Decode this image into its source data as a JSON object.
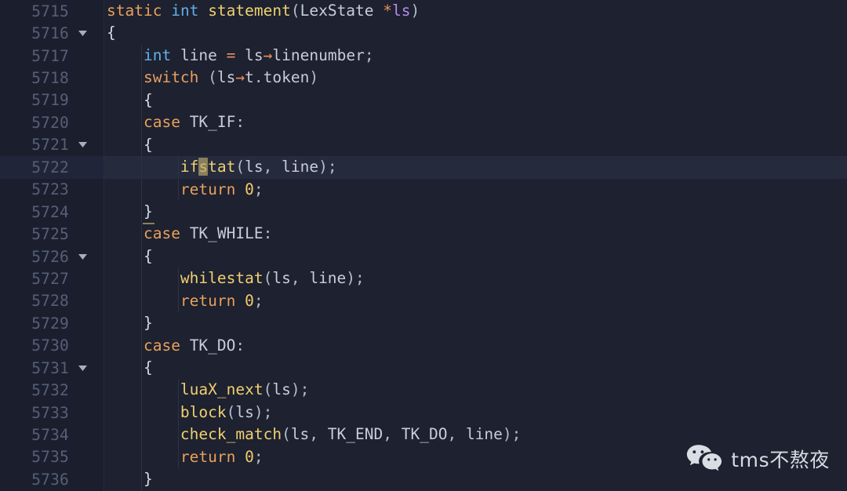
{
  "editor": {
    "theme": "dark",
    "background": "#1d2130",
    "gutter_background": "#1b1f2d",
    "active_line_background": "#252a3d",
    "line_number_color": "#565f78",
    "cursor_color": "#9a8e63",
    "language": "C",
    "active_line": 5722,
    "colors": {
      "keyword": "#e8a05c",
      "type": "#62b0e8",
      "function": "#f0d070",
      "identifier": "#c8cdd8",
      "operator": "#e8905c",
      "punctuation": "#b6bccb",
      "number": "#f5c96b",
      "parameter": "#b48ee8",
      "bracket_match_underline": "#8d8258"
    }
  },
  "lines": [
    {
      "number": "5715",
      "fold": false,
      "indent": 0,
      "tokens": [
        {
          "t": "static",
          "c": "kw"
        },
        {
          "t": " ",
          "c": "plain"
        },
        {
          "t": "int",
          "c": "type"
        },
        {
          "t": " ",
          "c": "plain"
        },
        {
          "t": "statement",
          "c": "fn"
        },
        {
          "t": "(",
          "c": "punct"
        },
        {
          "t": "LexState",
          "c": "ident"
        },
        {
          "t": " ",
          "c": "plain"
        },
        {
          "t": "*",
          "c": "op"
        },
        {
          "t": "ls",
          "c": "var"
        },
        {
          "t": ")",
          "c": "punct"
        }
      ]
    },
    {
      "number": "5716",
      "fold": true,
      "indent": 0,
      "tokens": [
        {
          "t": "{",
          "c": "brace"
        }
      ]
    },
    {
      "number": "5717",
      "fold": false,
      "indent": 1,
      "tokens": [
        {
          "t": "    ",
          "c": "plain"
        },
        {
          "t": "int",
          "c": "type"
        },
        {
          "t": " ",
          "c": "plain"
        },
        {
          "t": "line",
          "c": "ident"
        },
        {
          "t": " ",
          "c": "plain"
        },
        {
          "t": "=",
          "c": "op"
        },
        {
          "t": " ",
          "c": "plain"
        },
        {
          "t": "ls",
          "c": "ident"
        },
        {
          "t": "→",
          "c": "op"
        },
        {
          "t": "linenumber",
          "c": "ident"
        },
        {
          "t": ";",
          "c": "punct"
        }
      ]
    },
    {
      "number": "5718",
      "fold": false,
      "indent": 1,
      "tokens": [
        {
          "t": "    ",
          "c": "plain"
        },
        {
          "t": "switch",
          "c": "kw"
        },
        {
          "t": " ",
          "c": "plain"
        },
        {
          "t": "(",
          "c": "punct"
        },
        {
          "t": "ls",
          "c": "ident"
        },
        {
          "t": "→",
          "c": "op"
        },
        {
          "t": "t",
          "c": "ident"
        },
        {
          "t": ".",
          "c": "punct"
        },
        {
          "t": "token",
          "c": "ident"
        },
        {
          "t": ")",
          "c": "punct"
        }
      ]
    },
    {
      "number": "5719",
      "fold": false,
      "indent": 1,
      "tokens": [
        {
          "t": "    ",
          "c": "plain"
        },
        {
          "t": "{",
          "c": "brace"
        }
      ]
    },
    {
      "number": "5720",
      "fold": false,
      "indent": 1,
      "tokens": [
        {
          "t": "    ",
          "c": "plain"
        },
        {
          "t": "case",
          "c": "kw"
        },
        {
          "t": " ",
          "c": "plain"
        },
        {
          "t": "TK_IF",
          "c": "ident"
        },
        {
          "t": ":",
          "c": "punct"
        }
      ]
    },
    {
      "number": "5721",
      "fold": true,
      "indent": 1,
      "tokens": [
        {
          "t": "    ",
          "c": "plain"
        },
        {
          "t": "{",
          "c": "match"
        }
      ]
    },
    {
      "number": "5722",
      "fold": false,
      "indent": 2,
      "active": true,
      "tokens": [
        {
          "t": "        ",
          "c": "plain"
        },
        {
          "t": "if",
          "c": "fn"
        },
        {
          "t": "s",
          "c": "fn cursor"
        },
        {
          "t": "tat",
          "c": "fn"
        },
        {
          "t": "(",
          "c": "punct"
        },
        {
          "t": "ls",
          "c": "ident"
        },
        {
          "t": ",",
          "c": "punct"
        },
        {
          "t": " ",
          "c": "plain"
        },
        {
          "t": "line",
          "c": "ident"
        },
        {
          "t": ")",
          "c": "punct"
        },
        {
          "t": ";",
          "c": "punct"
        }
      ]
    },
    {
      "number": "5723",
      "fold": false,
      "indent": 2,
      "tokens": [
        {
          "t": "        ",
          "c": "plain"
        },
        {
          "t": "return",
          "c": "kw"
        },
        {
          "t": " ",
          "c": "plain"
        },
        {
          "t": "0",
          "c": "num"
        },
        {
          "t": ";",
          "c": "punct"
        }
      ]
    },
    {
      "number": "5724",
      "fold": false,
      "indent": 1,
      "tokens": [
        {
          "t": "    ",
          "c": "plain"
        },
        {
          "t": "}",
          "c": "match"
        }
      ]
    },
    {
      "number": "5725",
      "fold": false,
      "indent": 1,
      "tokens": [
        {
          "t": "    ",
          "c": "plain"
        },
        {
          "t": "case",
          "c": "kw"
        },
        {
          "t": " ",
          "c": "plain"
        },
        {
          "t": "TK_WHILE",
          "c": "ident"
        },
        {
          "t": ":",
          "c": "punct"
        }
      ]
    },
    {
      "number": "5726",
      "fold": true,
      "indent": 1,
      "tokens": [
        {
          "t": "    ",
          "c": "plain"
        },
        {
          "t": "{",
          "c": "brace"
        }
      ]
    },
    {
      "number": "5727",
      "fold": false,
      "indent": 2,
      "tokens": [
        {
          "t": "        ",
          "c": "plain"
        },
        {
          "t": "whilestat",
          "c": "fn"
        },
        {
          "t": "(",
          "c": "punct"
        },
        {
          "t": "ls",
          "c": "ident"
        },
        {
          "t": ",",
          "c": "punct"
        },
        {
          "t": " ",
          "c": "plain"
        },
        {
          "t": "line",
          "c": "ident"
        },
        {
          "t": ")",
          "c": "punct"
        },
        {
          "t": ";",
          "c": "punct"
        }
      ]
    },
    {
      "number": "5728",
      "fold": false,
      "indent": 2,
      "tokens": [
        {
          "t": "        ",
          "c": "plain"
        },
        {
          "t": "return",
          "c": "kw"
        },
        {
          "t": " ",
          "c": "plain"
        },
        {
          "t": "0",
          "c": "num"
        },
        {
          "t": ";",
          "c": "punct"
        }
      ]
    },
    {
      "number": "5729",
      "fold": false,
      "indent": 1,
      "tokens": [
        {
          "t": "    ",
          "c": "plain"
        },
        {
          "t": "}",
          "c": "brace"
        }
      ]
    },
    {
      "number": "5730",
      "fold": false,
      "indent": 1,
      "tokens": [
        {
          "t": "    ",
          "c": "plain"
        },
        {
          "t": "case",
          "c": "kw"
        },
        {
          "t": " ",
          "c": "plain"
        },
        {
          "t": "TK_DO",
          "c": "ident"
        },
        {
          "t": ":",
          "c": "punct"
        }
      ]
    },
    {
      "number": "5731",
      "fold": true,
      "indent": 1,
      "tokens": [
        {
          "t": "    ",
          "c": "plain"
        },
        {
          "t": "{",
          "c": "brace"
        }
      ]
    },
    {
      "number": "5732",
      "fold": false,
      "indent": 2,
      "tokens": [
        {
          "t": "        ",
          "c": "plain"
        },
        {
          "t": "luaX_next",
          "c": "fn"
        },
        {
          "t": "(",
          "c": "punct"
        },
        {
          "t": "ls",
          "c": "ident"
        },
        {
          "t": ")",
          "c": "punct"
        },
        {
          "t": ";",
          "c": "punct"
        }
      ]
    },
    {
      "number": "5733",
      "fold": false,
      "indent": 2,
      "tokens": [
        {
          "t": "        ",
          "c": "plain"
        },
        {
          "t": "block",
          "c": "fn"
        },
        {
          "t": "(",
          "c": "punct"
        },
        {
          "t": "ls",
          "c": "ident"
        },
        {
          "t": ")",
          "c": "punct"
        },
        {
          "t": ";",
          "c": "punct"
        }
      ]
    },
    {
      "number": "5734",
      "fold": false,
      "indent": 2,
      "tokens": [
        {
          "t": "        ",
          "c": "plain"
        },
        {
          "t": "check_match",
          "c": "fn"
        },
        {
          "t": "(",
          "c": "punct"
        },
        {
          "t": "ls",
          "c": "ident"
        },
        {
          "t": ",",
          "c": "punct"
        },
        {
          "t": " ",
          "c": "plain"
        },
        {
          "t": "TK_END",
          "c": "ident"
        },
        {
          "t": ",",
          "c": "punct"
        },
        {
          "t": " ",
          "c": "plain"
        },
        {
          "t": "TK_DO",
          "c": "ident"
        },
        {
          "t": ",",
          "c": "punct"
        },
        {
          "t": " ",
          "c": "plain"
        },
        {
          "t": "line",
          "c": "ident"
        },
        {
          "t": ")",
          "c": "punct"
        },
        {
          "t": ";",
          "c": "punct"
        }
      ]
    },
    {
      "number": "5735",
      "fold": false,
      "indent": 2,
      "tokens": [
        {
          "t": "        ",
          "c": "plain"
        },
        {
          "t": "return",
          "c": "kw"
        },
        {
          "t": " ",
          "c": "plain"
        },
        {
          "t": "0",
          "c": "num"
        },
        {
          "t": ";",
          "c": "punct"
        }
      ]
    },
    {
      "number": "5736",
      "fold": false,
      "indent": 1,
      "tokens": [
        {
          "t": "    ",
          "c": "plain"
        },
        {
          "t": "}",
          "c": "brace"
        }
      ]
    }
  ],
  "watermark": {
    "icon": "wechat-logo-icon",
    "text": "tms不熬夜"
  }
}
